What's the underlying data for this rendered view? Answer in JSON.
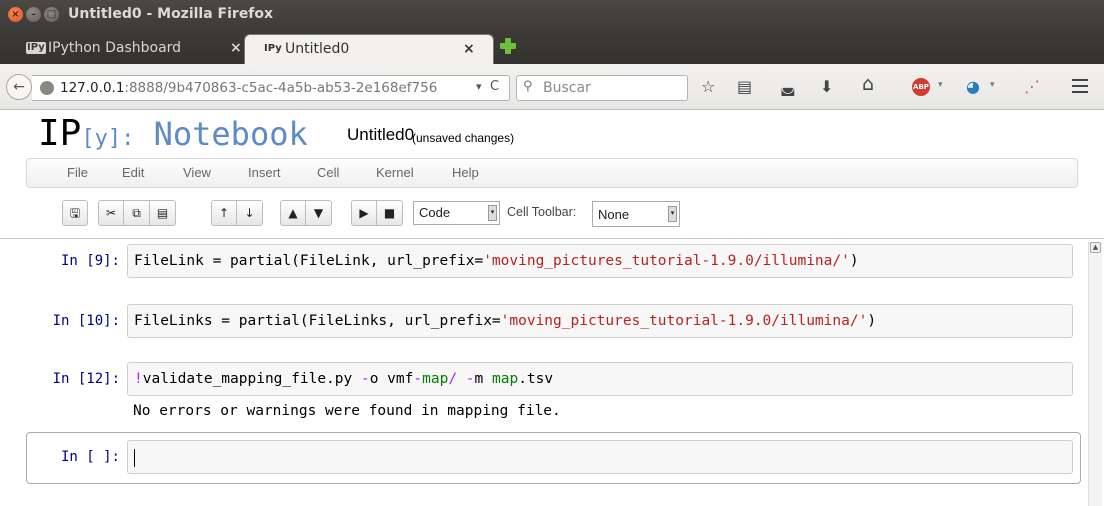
{
  "window": {
    "title": "Untitled0 - Mozilla Firefox",
    "close_glyph": "×",
    "min_glyph": "–",
    "max_glyph": "□"
  },
  "tabs": [
    {
      "icon_text": "IPy",
      "label": "IPython Dashboard",
      "close": "×"
    },
    {
      "icon_text": "IPy",
      "label": "Untitled0",
      "close": "×"
    }
  ],
  "navbar": {
    "back_glyph": "←",
    "url_host": "127.0.0.1",
    "url_rest": ":8888/9b470863-c5ac-4a5b-ab53-2e168ef756",
    "url_drop": "▾",
    "url_reload": "C",
    "search_placeholder": "Buscar",
    "icons": {
      "bookmark": "☆",
      "reader": "▤",
      "pocket": "◛",
      "download": "⬇",
      "home": "⌂",
      "abp": "ABP",
      "drop": "▾",
      "globe": "◕",
      "chart": "⋰"
    }
  },
  "notebook": {
    "logo_ip": "IP",
    "logo_y": "[y]:",
    "logo_nb": " Notebook",
    "name": "Untitled0",
    "status": "(unsaved changes)"
  },
  "menu": [
    "File",
    "Edit",
    "View",
    "Insert",
    "Cell",
    "Kernel",
    "Help"
  ],
  "toolbar": {
    "icons": [
      "🖫",
      "✂",
      "⧉",
      "▤",
      "↑",
      "↓",
      "▲",
      "▼",
      "▶",
      "■"
    ],
    "cell_type": "Code",
    "cell_toolbar_label": "Cell Toolbar:",
    "cell_toolbar_value": "None",
    "select_arrow": "▾"
  },
  "cells": [
    {
      "prompt": "In [9]:",
      "code_pre": "FileLink = partial(FileLink, url_prefix=",
      "code_str": "'moving_pictures_tutorial-1.9.0/illumina/'",
      "code_post": ")"
    },
    {
      "prompt": "In [10]:",
      "code_pre": "FileLinks = partial(FileLinks, url_prefix=",
      "code_str": "'moving_pictures_tutorial-1.9.0/illumina/'",
      "code_post": ")"
    },
    {
      "prompt": "In [12]:",
      "bang": "!",
      "c1": "validate_mapping_file.py ",
      "op1": "-",
      "c2": "o vmf",
      "op2": "-",
      "g1": "map",
      "op3": "/",
      "c3": " ",
      "op4": "-",
      "c4": "m ",
      "g2": "map",
      "c5": ".tsv",
      "output": "No errors or warnings were found in mapping file."
    },
    {
      "prompt": "In [ ]:"
    }
  ],
  "scroll_up": "▲"
}
